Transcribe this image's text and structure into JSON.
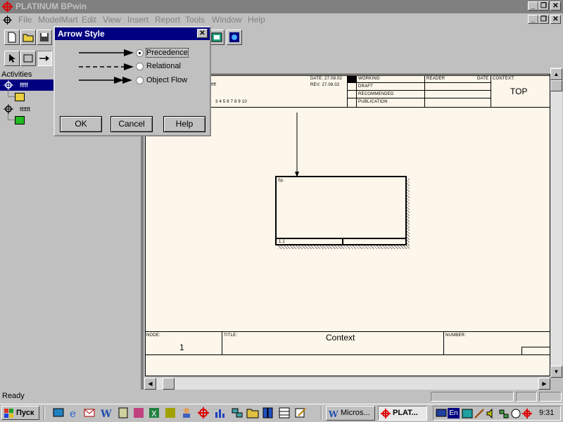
{
  "window": {
    "title": "PLATINUM BPwin",
    "controls": [
      "_",
      "🗗",
      "✕"
    ]
  },
  "menu": [
    "File",
    "ModelMart",
    "Edit",
    "View",
    "Insert",
    "Report",
    "Tools",
    "Window",
    "Help"
  ],
  "tree": {
    "header": "Activities",
    "items": [
      {
        "label": "fffff"
      },
      {
        "label": "tttttt"
      }
    ]
  },
  "dialog": {
    "title": "Arrow Style",
    "options": [
      {
        "label": "Precedence",
        "selected": true
      },
      {
        "label": "Relational",
        "selected": false
      },
      {
        "label": "Object Flow",
        "selected": false
      }
    ],
    "buttons": {
      "ok": "OK",
      "cancel": "Cancel",
      "help": "Help"
    }
  },
  "diagram_header": {
    "date": "DATE: 27.08.02",
    "rev": "REV: 27.08.02",
    "name_fragment": "ffff",
    "numbers": "3 4 5 6 7 8 9 10",
    "working": "WORKING",
    "draft": "DRAFT",
    "recommended": "RECOMMENDED",
    "publication": "PUBLICATION",
    "reader": "READER",
    "date_col": "DATE",
    "context_label": "CONTEXT:",
    "context_value": "TOP"
  },
  "box": {
    "label": "0p.",
    "number": "1.1"
  },
  "footer": {
    "node_label": "NODE:",
    "node_value": "1",
    "title_label": "TITLE:",
    "title_value": "Context",
    "number_label": "NUMBER:"
  },
  "statusbar": {
    "text": "Ready"
  },
  "taskbar": {
    "start": "Пуск",
    "tasks": [
      {
        "label": "Micros...",
        "active": false
      },
      {
        "label": "PLAT...",
        "active": true
      }
    ],
    "clock": "9:31",
    "lang": "En"
  }
}
